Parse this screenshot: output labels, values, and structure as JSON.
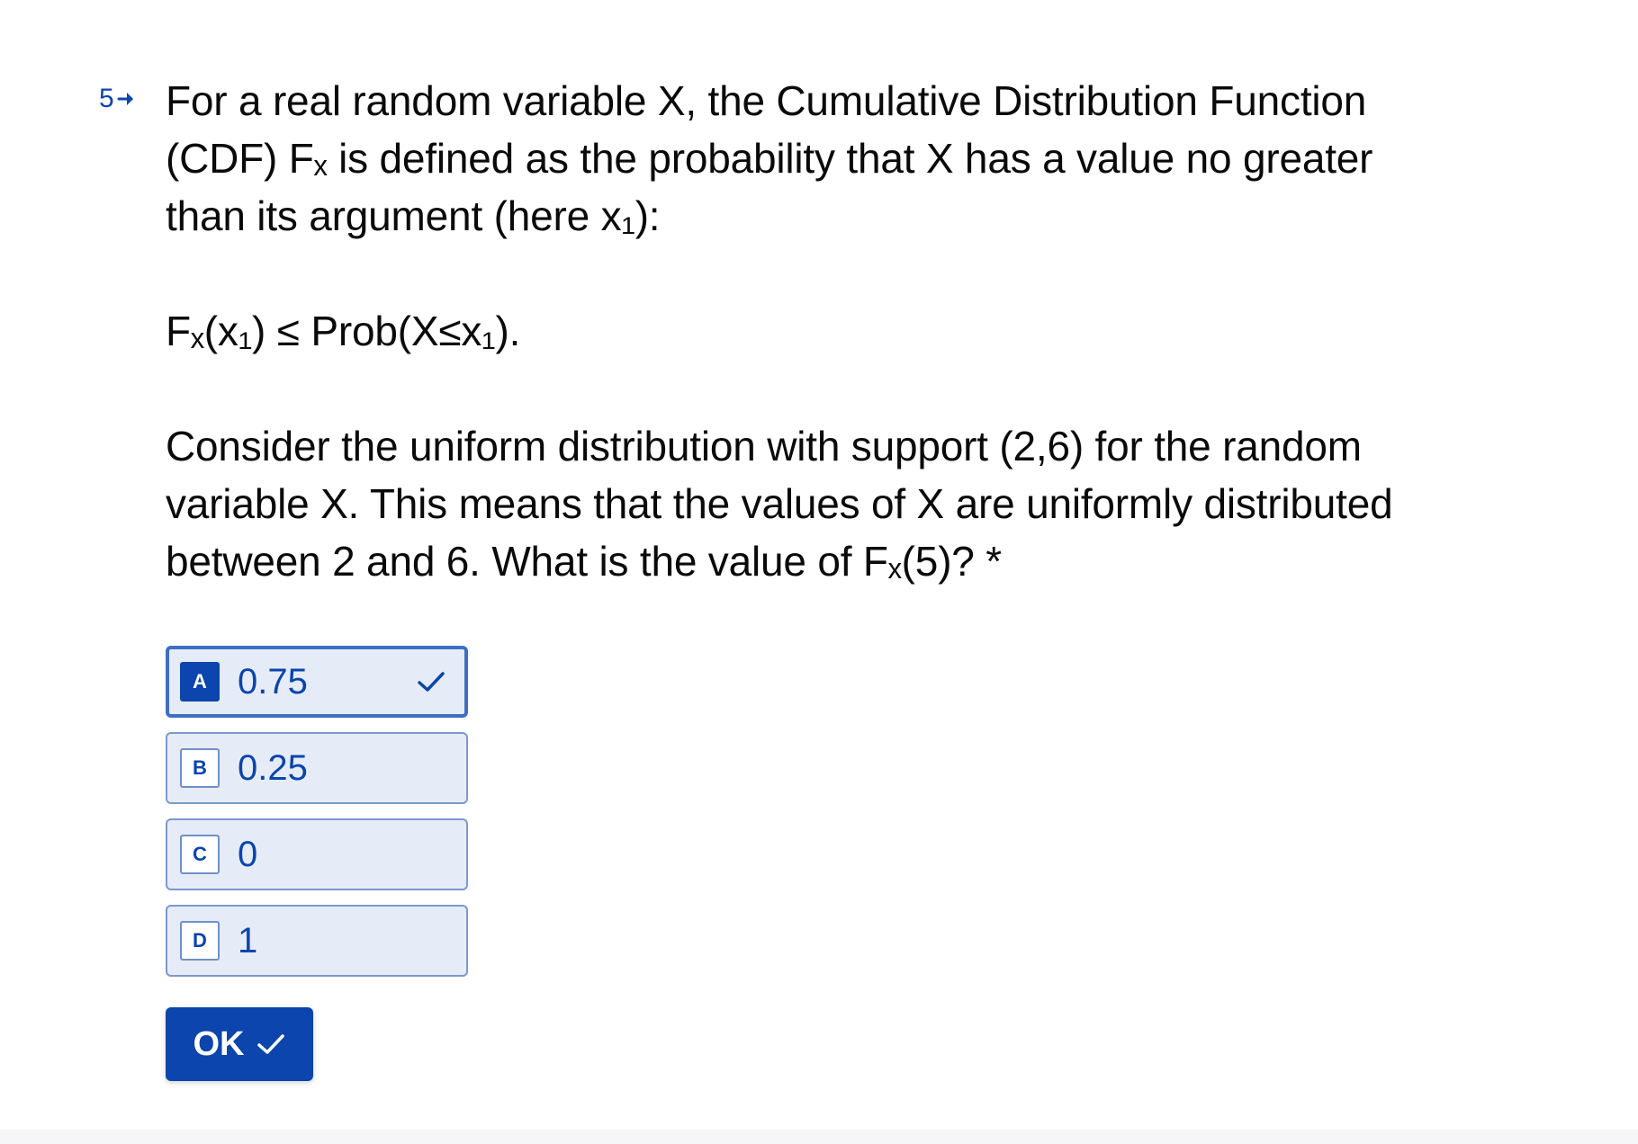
{
  "question": {
    "number": "5",
    "paragraph1": "For a real random variable X, the Cumulative Distribution Function (CDF) Fₓ is defined as the probability that X has a value no greater than its argument (here x₁):",
    "formula": "Fₓ(x₁) ≤ Prob(X≤x₁).",
    "paragraph2": "Consider the uniform distribution with support (2,6) for the random variable X. This means that the values of X are uniformly distributed between 2 and 6. What is the value of Fₓ(5)? *"
  },
  "choices": [
    {
      "key": "A",
      "label": "0.75",
      "selected": true
    },
    {
      "key": "B",
      "label": "0.25",
      "selected": false
    },
    {
      "key": "C",
      "label": "0",
      "selected": false
    },
    {
      "key": "D",
      "label": "1",
      "selected": false
    }
  ],
  "ok_button": {
    "label": "OK"
  },
  "colors": {
    "accent": "#0b45ad",
    "choice_background": "#e6ecf7",
    "choice_border": "#7b99cf",
    "selected_border": "#3f6fc4"
  },
  "icons": {
    "question_marker": "arrow-right-icon",
    "selected_marker": "checkmark-icon",
    "ok_marker": "checkmark-icon"
  }
}
